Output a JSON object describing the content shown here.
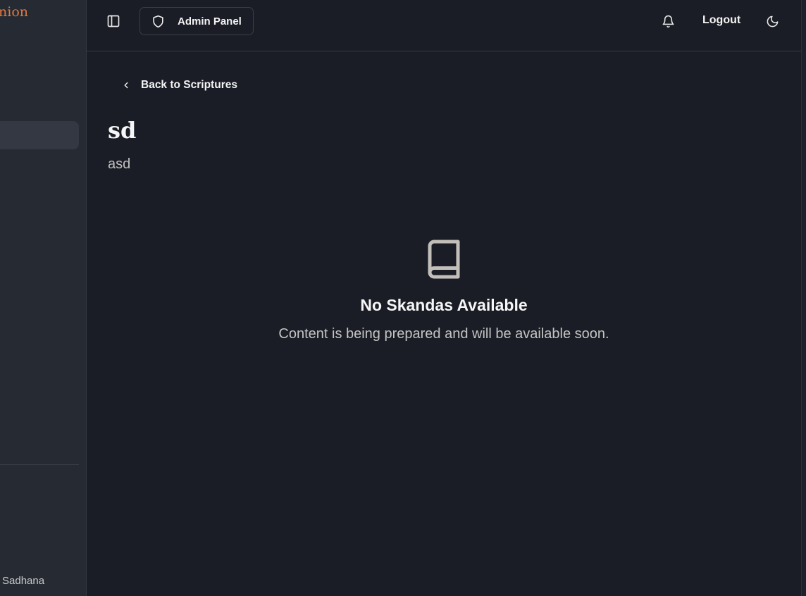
{
  "sidebar": {
    "brand": "nion",
    "footer": "Sadhana"
  },
  "header": {
    "admin_panel_label": "Admin Panel",
    "logout_label": "Logout"
  },
  "main": {
    "back_label": "Back to Scriptures",
    "title": "sd",
    "subtitle": "asd",
    "empty_state": {
      "heading": "No Skandas Available",
      "message": "Content is being prepared and will be available soon."
    }
  },
  "colors": {
    "background": "#1a1d25",
    "sidebar": "#262a33",
    "brand_accent": "#e0793f"
  },
  "icons": [
    "sidebar-toggle-icon",
    "shield-icon",
    "bell-icon",
    "moon-icon",
    "chevron-left-icon",
    "book-icon"
  ]
}
